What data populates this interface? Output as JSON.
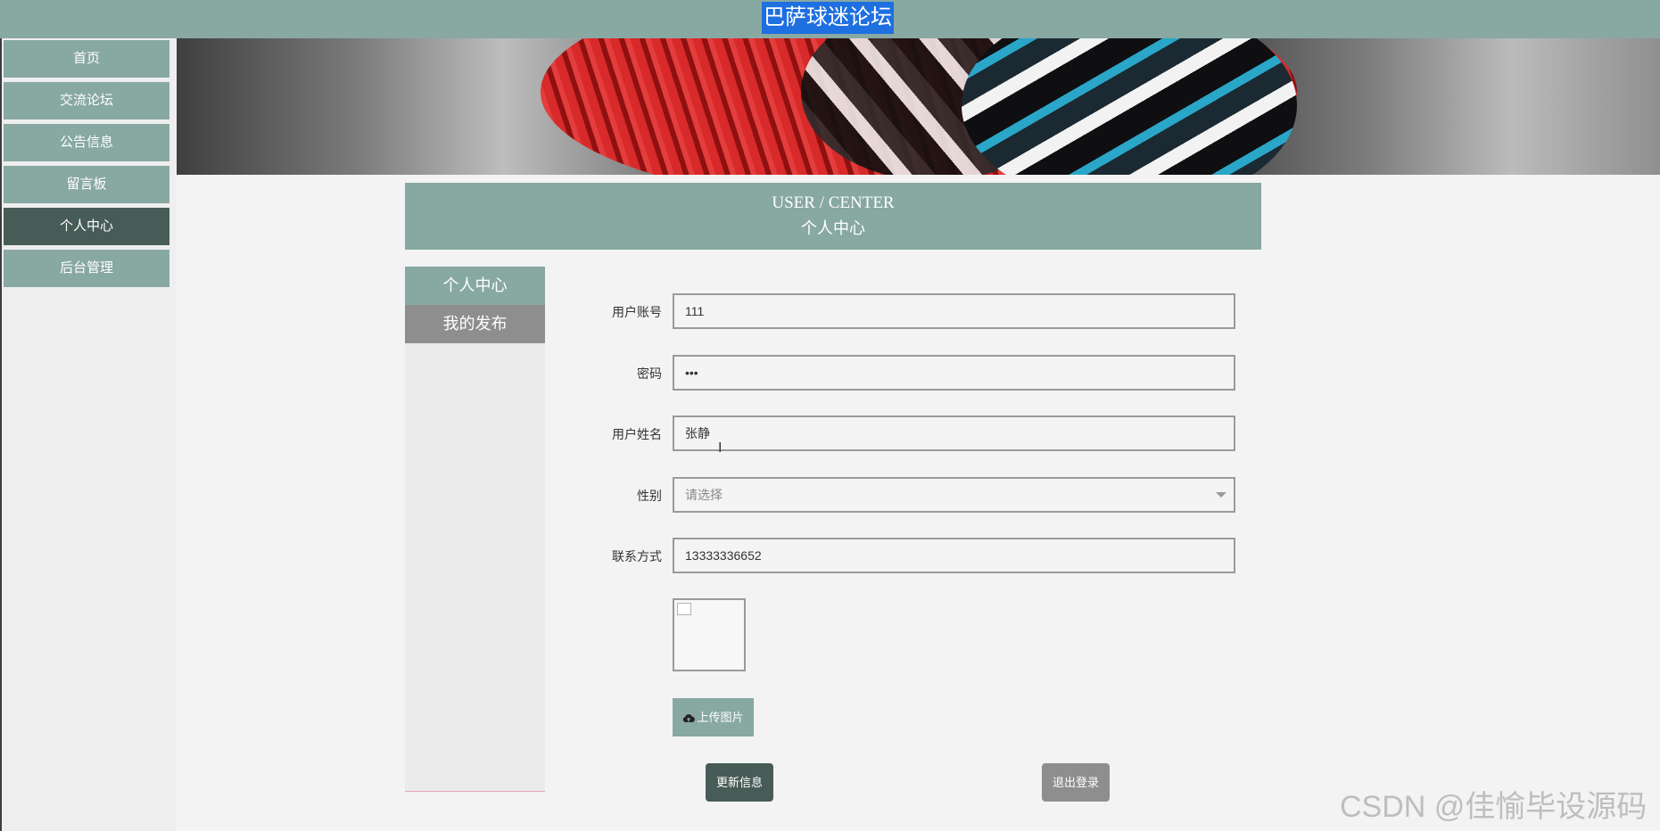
{
  "header": {
    "site_title": "巴萨球迷论坛"
  },
  "sidebar": {
    "items": [
      {
        "label": "首页",
        "active": false
      },
      {
        "label": "交流论坛",
        "active": false
      },
      {
        "label": "公告信息",
        "active": false
      },
      {
        "label": "留言板",
        "active": false
      },
      {
        "label": "个人中心",
        "active": true
      },
      {
        "label": "后台管理",
        "active": false
      }
    ]
  },
  "user_center": {
    "title_en": "USER / CENTER",
    "title_cn": "个人中心",
    "tabs": [
      {
        "label": "个人中心"
      },
      {
        "label": "我的发布"
      }
    ]
  },
  "form": {
    "account": {
      "label": "用户账号",
      "value": "111"
    },
    "password": {
      "label": "密码",
      "value": "•••"
    },
    "name": {
      "label": "用户姓名",
      "value": "张静"
    },
    "gender": {
      "label": "性别",
      "placeholder": "请选择"
    },
    "phone": {
      "label": "联系方式",
      "value": "13333336652"
    }
  },
  "buttons": {
    "upload": "上传图片",
    "update": "更新信息",
    "logout": "退出登录"
  },
  "watermark": "CSDN @佳愉毕设源码",
  "colors": {
    "accent": "#88a8a2",
    "active": "#475c57",
    "secondary": "#8e8e8e"
  }
}
